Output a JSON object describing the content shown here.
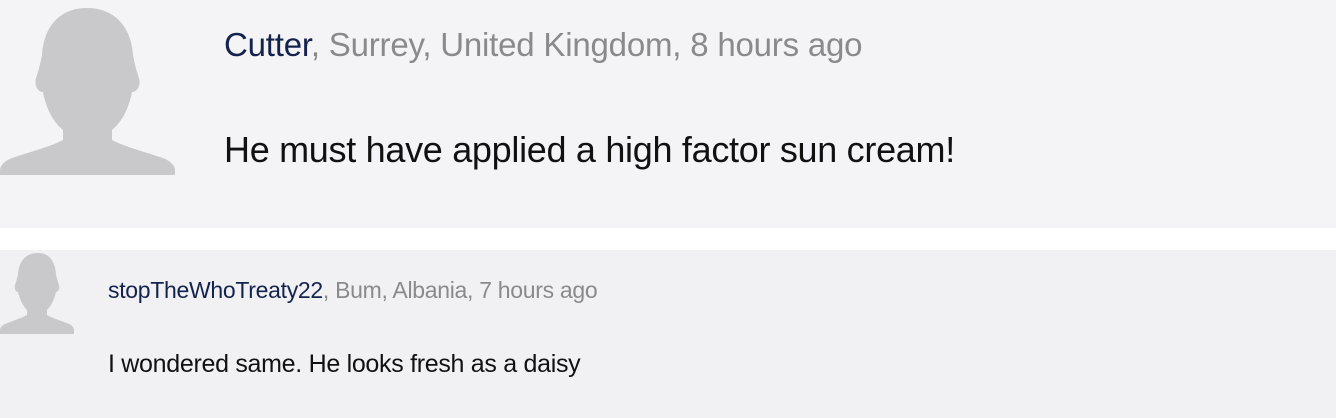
{
  "comments": [
    {
      "author": "Cutter",
      "location": ", Surrey, United Kingdom, 8 hours ago",
      "body": "He must have applied a high factor sun cream!",
      "avatar_icon": "default-user-silhouette-icon"
    },
    {
      "author": "stopTheWhoTreaty22",
      "location": ", Bum, Albania, 7 hours ago",
      "body": "I wondered same. He looks fresh as a daisy",
      "avatar_icon": "default-user-silhouette-icon"
    }
  ],
  "colors": {
    "author": "#14234d",
    "meta": "#8a8a8c",
    "body": "#111111",
    "avatar": "#c9c9cb",
    "comment_bg": "#f4f4f6"
  }
}
